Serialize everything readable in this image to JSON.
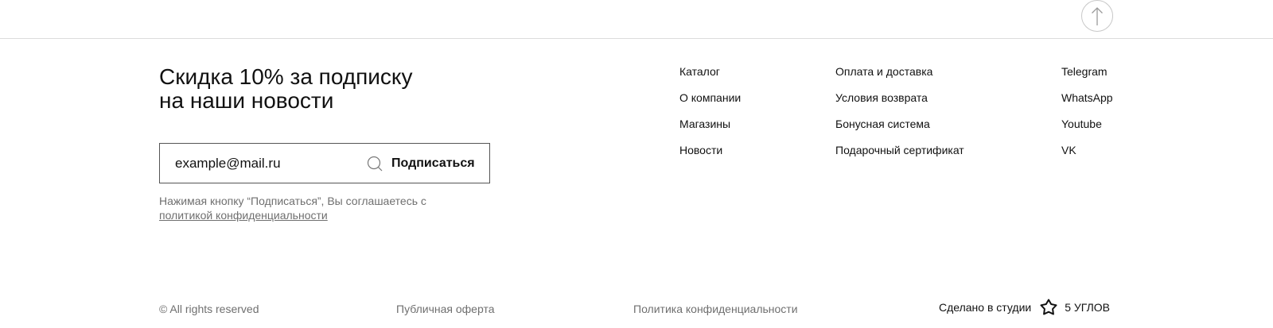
{
  "scroll_top": {
    "icon": "arrow-up-icon"
  },
  "subscribe": {
    "title_line1": "Скидка 10% за подписку",
    "title_line2": "на наши новости",
    "email_value": "example@mail.ru",
    "button_label": "Подписаться",
    "icon": "search-icon",
    "consent_text": "Нажимая кнопку “Подписаться”, Вы соглашаетесь с",
    "consent_link": "политикой конфиденциальности"
  },
  "nav": {
    "col1": [
      "Каталог",
      "О компании",
      "Магазины",
      "Новости"
    ],
    "col2": [
      "Оплата и доставка",
      "Условия возврата",
      "Бонусная система",
      "Подарочный сертификат"
    ],
    "col3": [
      "Telegram",
      "WhatsApp",
      "Youtube",
      "VK"
    ]
  },
  "footer": {
    "copyright": "© All rights reserved",
    "offer": "Публичная оферта",
    "privacy": "Политика конфиденциальности",
    "studio_prefix": "Сделано в студии",
    "studio_name": "5 УГЛОВ",
    "studio_logo": "pentagon-star-logo"
  },
  "colors": {
    "text": "#111111",
    "muted": "#6f6f6f",
    "border": "#555555",
    "divider": "#dcdcdc"
  }
}
